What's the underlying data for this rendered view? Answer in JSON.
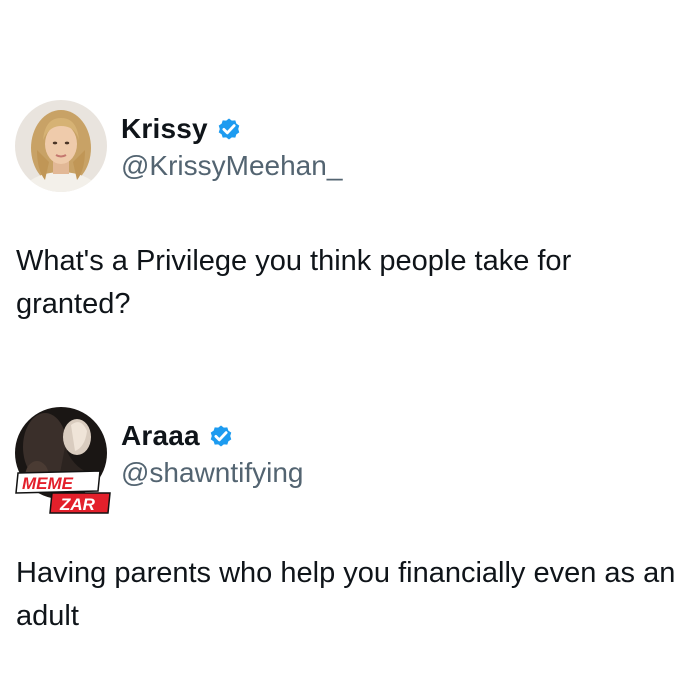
{
  "tweets": [
    {
      "display_name": "Krissy",
      "handle": "@KrissyMeehan_",
      "verified_icon": "verified-badge-icon",
      "text": "What's a Privilege you think people take for granted?"
    },
    {
      "display_name": "Araaa",
      "handle": "@shawntifying",
      "verified_icon": "verified-badge-icon",
      "text": "Having parents who help you financially even as an adult"
    }
  ],
  "watermark": {
    "line1": "MEME",
    "line2": "ZAR"
  },
  "colors": {
    "verified_blue": "#1d9bf0",
    "handle_gray": "#536471",
    "text": "#0f1419",
    "watermark_red": "#e3202b"
  }
}
